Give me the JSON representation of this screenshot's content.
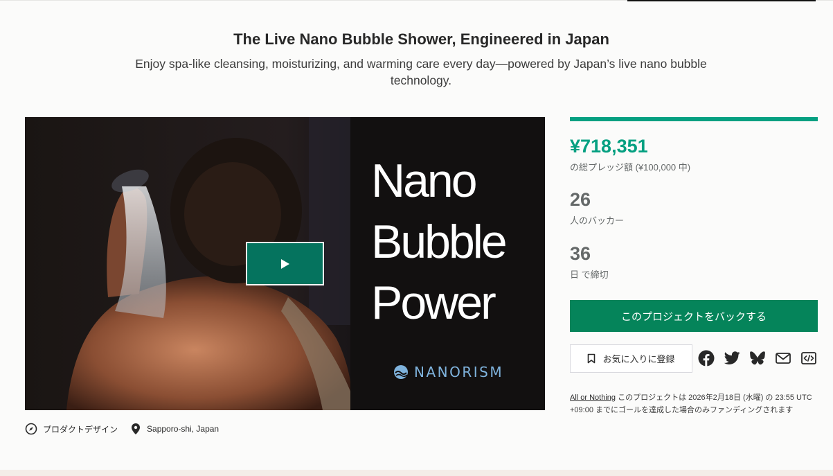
{
  "project": {
    "title": "The Live Nano Bubble Shower, Engineered in Japan",
    "blurb": "Enjoy spa-like cleansing, moisturizing, and warming care every day—powered by Japan’s live nano bubble technology."
  },
  "video": {
    "headline": "Nano\nBubble\nPower",
    "logo_text": "NANORISM",
    "play_icon": "play-icon"
  },
  "meta": {
    "category": "プロダクトデザイン",
    "category_icon": "compass-icon",
    "location": "Sapporo-shi, Japan",
    "location_icon": "map-pin-icon"
  },
  "stats": {
    "progress_percent": 100,
    "pledged": "¥718,351",
    "pledged_label": "の総プレッジ額 (¥100,000 中)",
    "backers": "26",
    "backers_label": "人のバッカー",
    "days": "36",
    "days_label": "日 で締切"
  },
  "actions": {
    "back_label": "このプロジェクトをバックする",
    "remind_label": "お気に入りに登録",
    "remind_icon": "bookmark-icon",
    "share_icons": [
      "facebook-icon",
      "twitter-icon",
      "bluesky-icon",
      "mail-icon",
      "embed-icon"
    ]
  },
  "funding_note": {
    "link": "All or Nothing",
    "text": " このプロジェクトは 2026年2月18日 (水曜) の 23:55 UTC +09:00 までにゴールを達成した場合のみファンディングされます"
  },
  "colors": {
    "accent": "#05a081",
    "back_button": "#05845a",
    "play_button": "#05735e"
  }
}
